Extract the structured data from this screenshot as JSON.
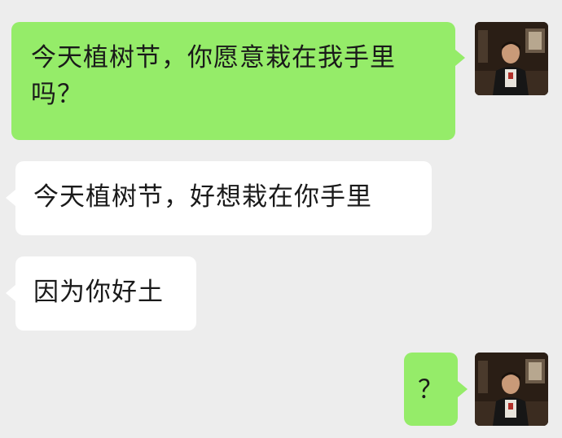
{
  "conversation": {
    "messages": [
      {
        "side": "right",
        "text": "今天植树节，你愿意栽在我手里吗？"
      },
      {
        "side": "left",
        "text": "今天植树节，好想栽在你手里"
      },
      {
        "side": "left",
        "text": "因为你好土"
      },
      {
        "side": "right",
        "text": "？"
      }
    ]
  },
  "colors": {
    "background": "#ededed",
    "outgoing_bubble": "#95ec69",
    "incoming_bubble": "#ffffff",
    "text": "#1a1a1a"
  },
  "icons": {
    "own_avatar": "avatar-photo-icon"
  }
}
